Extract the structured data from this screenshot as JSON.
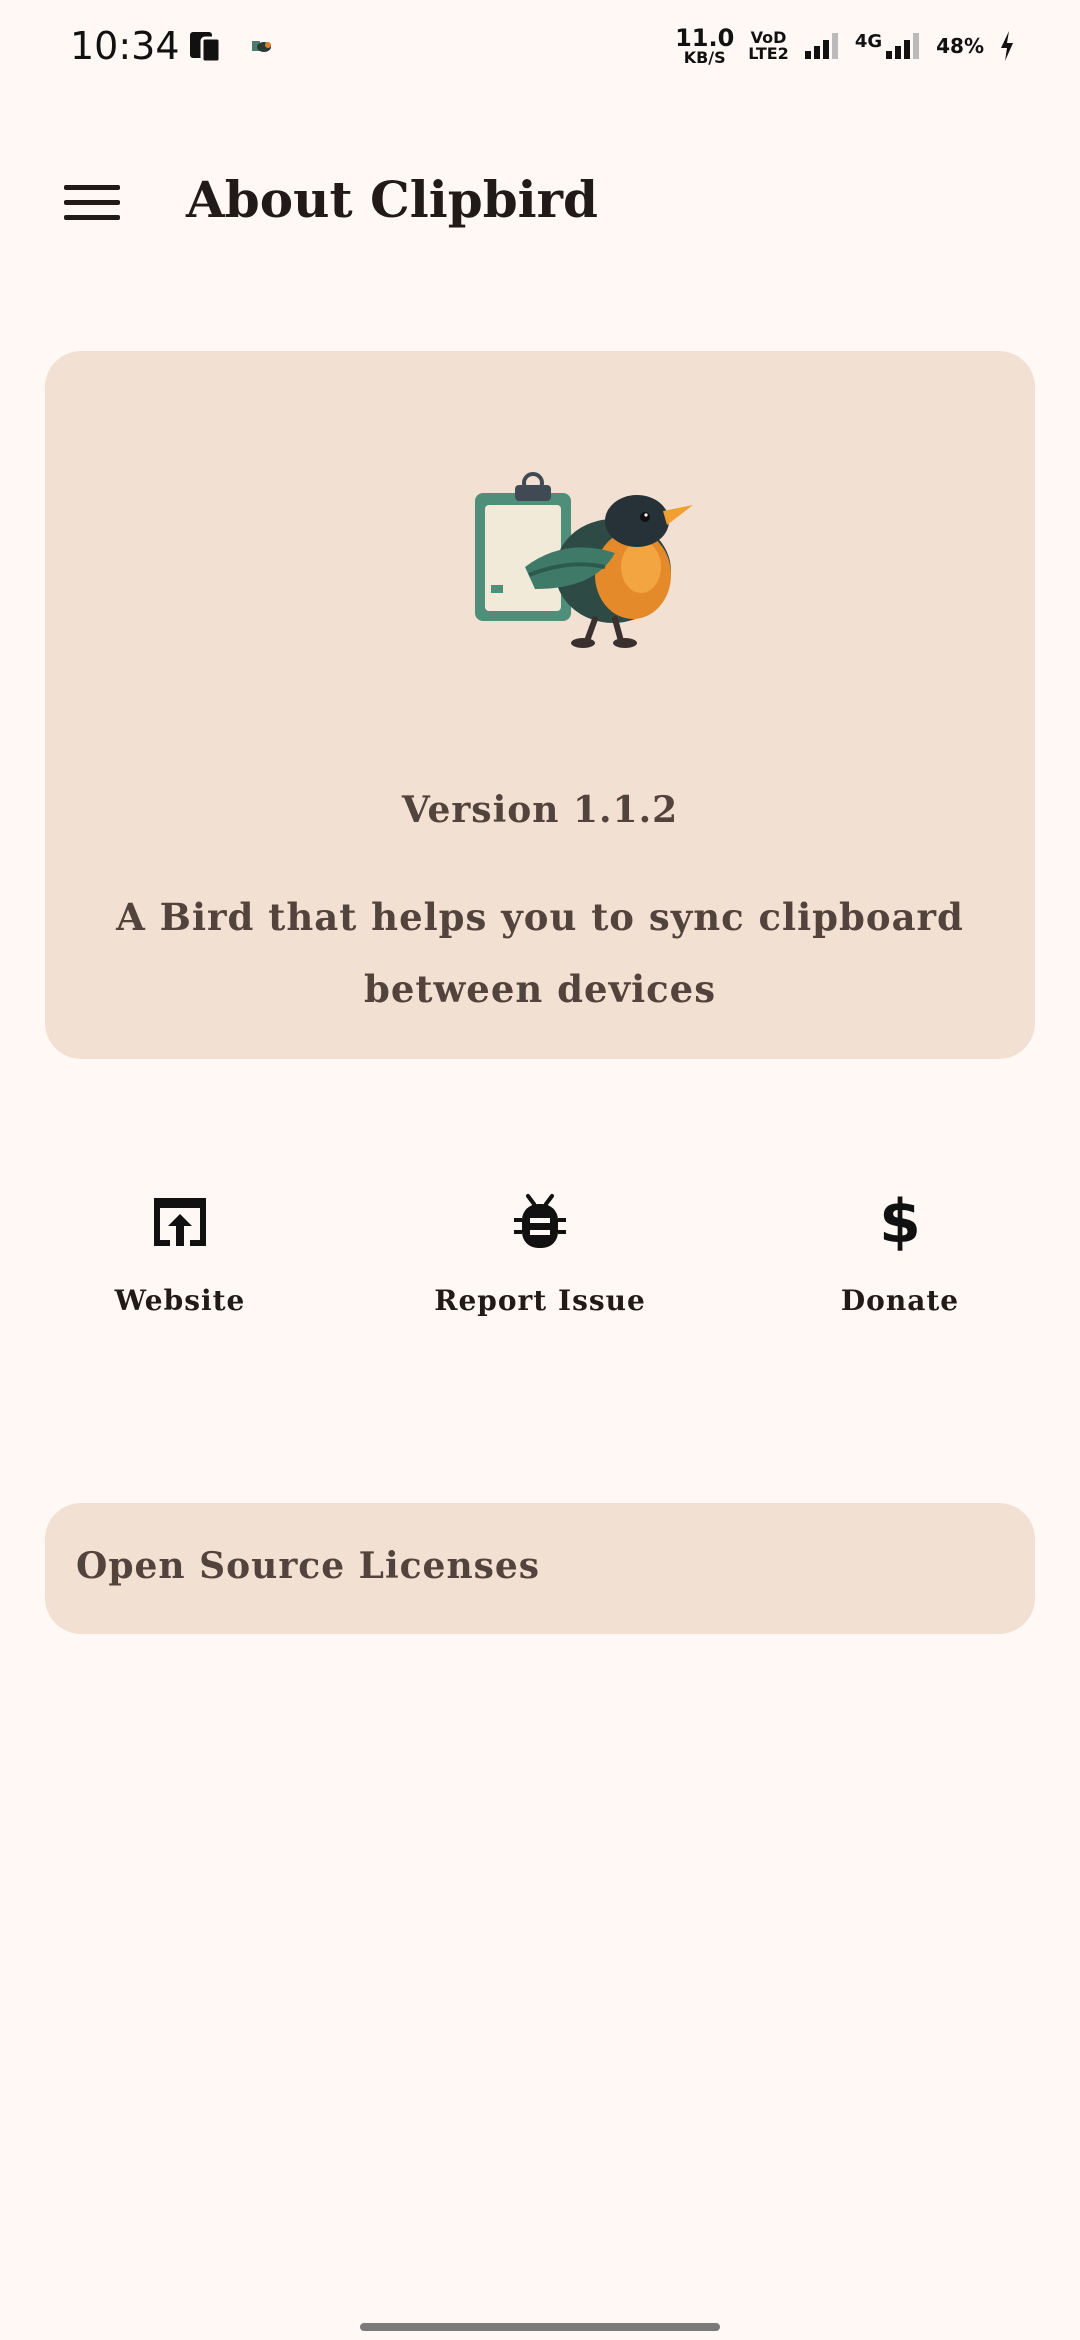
{
  "status_bar": {
    "time": "10:34",
    "net_speed_value": "11.0",
    "net_speed_unit": "KB/S",
    "vod_top": "VoD",
    "vod_bottom": "LTE2",
    "network": "4G",
    "battery": "48%"
  },
  "app_bar": {
    "title": "About Clipbird"
  },
  "info_card": {
    "version": "Version 1.1.2",
    "description": "A Bird that helps you to sync clipboard between devices"
  },
  "actions": [
    {
      "label": "Website",
      "icon": "open-in-browser-icon"
    },
    {
      "label": "Report Issue",
      "icon": "bug-icon"
    },
    {
      "label": "Donate",
      "icon": "dollar-icon"
    }
  ],
  "licenses": {
    "label": "Open Source Licenses"
  },
  "colors": {
    "background": "#fff8f5",
    "card": "#f2e0d3",
    "card_text": "#52433c",
    "primary_text": "#201a18"
  }
}
